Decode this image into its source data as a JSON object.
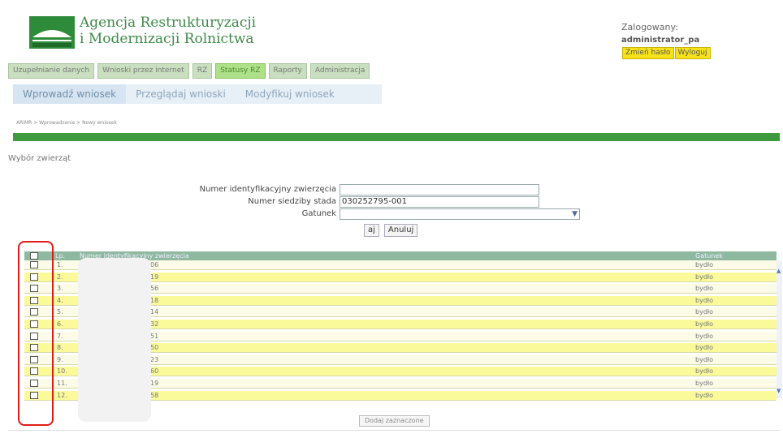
{
  "header": {
    "agency_line1": "Agencja Restrukturyzacji",
    "agency_line2": "i Modernizacji Rolnictwa",
    "logo_icon": "arimr-logo-icon",
    "user_label": "Zalogowany:",
    "user_name": "administrator_pa",
    "change_password": "Zmień hasło",
    "logout": "Wyloguj"
  },
  "topnav": [
    {
      "label": "Uzupełnianie danych"
    },
    {
      "label": "Wnioski przez internet"
    },
    {
      "label": "RZ"
    },
    {
      "label": "Statusy RZ"
    },
    {
      "label": "Raporty"
    },
    {
      "label": "Administracja"
    }
  ],
  "subnav": [
    {
      "label": "Wprowadź wniosek"
    },
    {
      "label": "Przeglądaj wnioski"
    },
    {
      "label": "Modyfikuj wniosek"
    }
  ],
  "breadcrumb": "ARiMR > Wprowadzanie > Nowy wniosek",
  "section_title": "Wybór zwierząt",
  "form": {
    "num_label": "Numer identyfikacyjny zwierzęcia",
    "num_value": "",
    "sid_label": "Numer siedziby stada",
    "sid_value": "030252795-001",
    "gat_label": "Gatunek",
    "gat_value": "",
    "search_btn": "aj",
    "cancel_btn": "Anuluj"
  },
  "table": {
    "headers": [
      "Lp.",
      "Numer identyfikacyjny zwierzęcia",
      "Gatunek"
    ],
    "rows": [
      {
        "lp": "1.",
        "id": "06",
        "gat": "bydło"
      },
      {
        "lp": "2.",
        "id": "19",
        "gat": "bydło"
      },
      {
        "lp": "3.",
        "id": "56",
        "gat": "bydło"
      },
      {
        "lp": "4.",
        "id": "18",
        "gat": "bydło"
      },
      {
        "lp": "5.",
        "id": "14",
        "gat": "bydło"
      },
      {
        "lp": "6.",
        "id": "32",
        "gat": "bydło"
      },
      {
        "lp": "7.",
        "id": "51",
        "gat": "bydło"
      },
      {
        "lp": "8.",
        "id": "50",
        "gat": "bydło"
      },
      {
        "lp": "9.",
        "id": "23",
        "gat": "bydło"
      },
      {
        "lp": "10.",
        "id": "60",
        "gat": "bydło"
      },
      {
        "lp": "11.",
        "id": "19",
        "gat": "bydło"
      },
      {
        "lp": "12.",
        "id": "58",
        "gat": "bydło"
      }
    ]
  },
  "submit_label": "Dodaj zaznaczone",
  "colors": {
    "brand_green": "#3f9a3f",
    "row_yellow": "#fafa9a",
    "row_cream": "#fbfbe8",
    "highlight_red": "#e21a1a"
  }
}
